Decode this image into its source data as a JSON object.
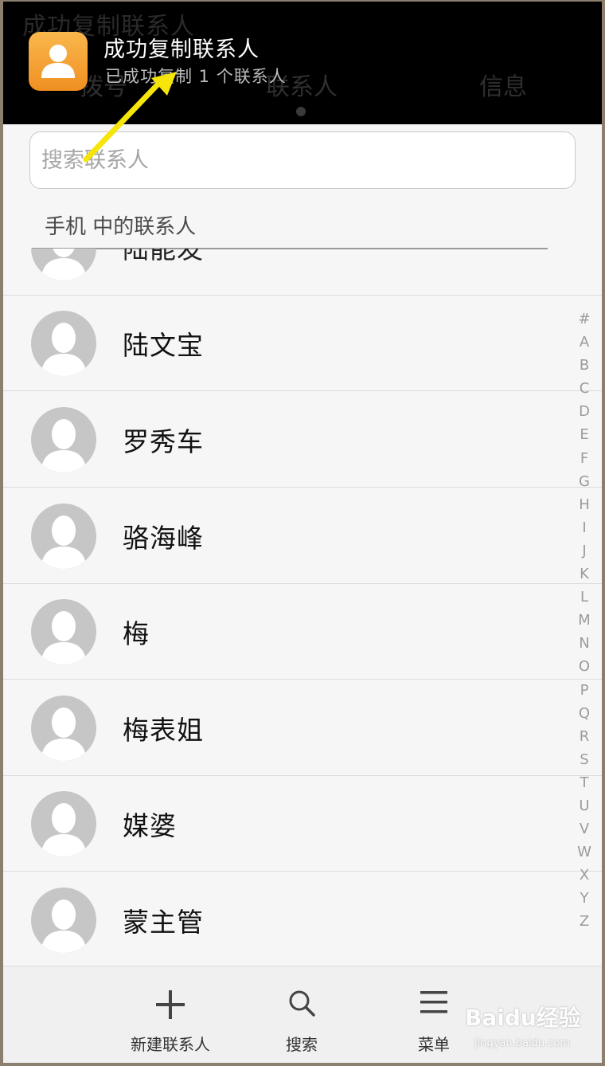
{
  "header": {
    "ghost_title": "成功复制联系人",
    "tabs": [
      "拨号",
      "联系人",
      "信息"
    ]
  },
  "notification": {
    "title": "成功复制联系人",
    "subtitle": "已成功复制 1 个联系人",
    "icon": "contact-person-icon",
    "accent": "#f4a032"
  },
  "search": {
    "placeholder": "搜索联系人"
  },
  "section": {
    "title": "手机 中的联系人"
  },
  "contacts": {
    "partial": "陆能发",
    "items": [
      "陆文宝",
      "罗秀车",
      "骆海峰",
      "梅",
      "梅表姐",
      "媒婆",
      "蒙主管"
    ]
  },
  "index_letters": [
    "#",
    "A",
    "B",
    "C",
    "D",
    "E",
    "F",
    "G",
    "H",
    "I",
    "J",
    "K",
    "L",
    "M",
    "N",
    "O",
    "P",
    "Q",
    "R",
    "S",
    "T",
    "U",
    "V",
    "W",
    "X",
    "Y",
    "Z"
  ],
  "bottom_bar": {
    "new_contact": "新建联系人",
    "search": "搜索",
    "menu": "菜单"
  },
  "watermark": {
    "brand": "Baidu经验",
    "url": "jingyan.baidu.com"
  }
}
